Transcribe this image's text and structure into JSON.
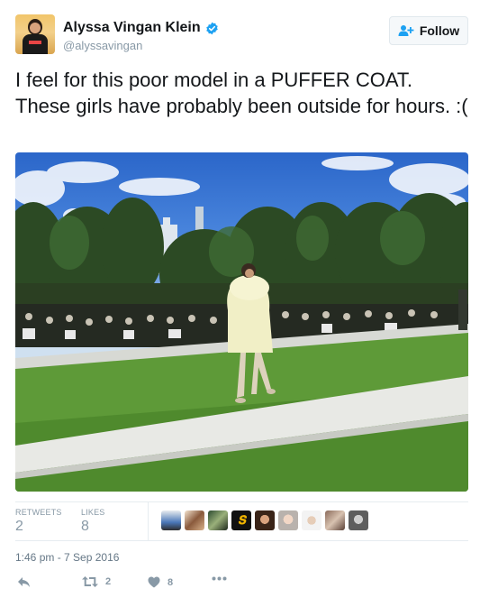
{
  "author": {
    "name": "Alyssa Vingan Klein",
    "handle": "@alyssavingan",
    "verified": true,
    "verified_icon": "verified-badge-icon",
    "avatar": "profile-avatar"
  },
  "follow_button": {
    "label": "Follow",
    "icon": "add-user-icon"
  },
  "tweet": {
    "text": "I feel for this poor model in a PUFFER COAT. These girls have probably been outside for hours. :(",
    "photo": "runway-photo"
  },
  "stats": {
    "retweets_label": "RETWEETS",
    "retweets_count": "2",
    "likes_label": "LIKES",
    "likes_count": "8",
    "liker_avatar_count": 9
  },
  "timestamp": "1:46 pm - 7 Sep 2016",
  "actions": {
    "reply_icon": "reply-icon",
    "retweet_icon": "retweet-icon",
    "retweet_count": "2",
    "like_icon": "heart-icon",
    "like_count": "8",
    "more_icon": "more-icon"
  },
  "colors": {
    "text": "#14171a",
    "muted": "#8899a6",
    "verified": "#1da1f2",
    "follow_icon": "#1da1f2",
    "divider": "#e6ecf0"
  }
}
